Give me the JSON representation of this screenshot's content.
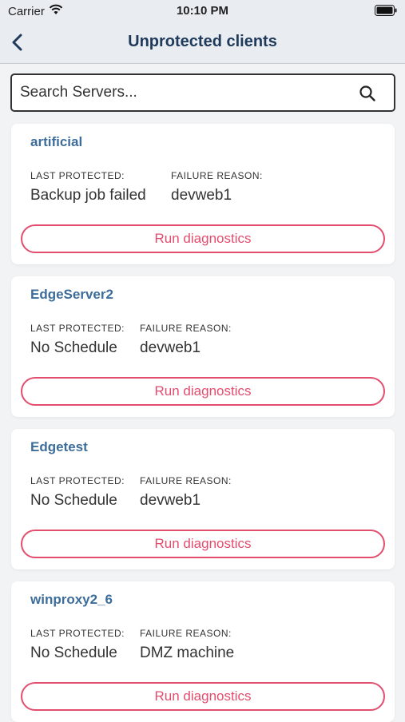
{
  "status_bar": {
    "carrier": "Carrier",
    "time": "10:10 PM",
    "icons": [
      "wifi-icon",
      "battery-icon"
    ]
  },
  "nav": {
    "title": "Unprotected clients",
    "back_icon": "chevron-left-icon"
  },
  "search": {
    "placeholder": "Search Servers...",
    "value": "",
    "icon": "search-icon"
  },
  "labels": {
    "last_protected": "LAST PROTECTED:",
    "failure_reason": "FAILURE REASON:",
    "button": "Run diagnostics"
  },
  "clients": [
    {
      "name": "artificial",
      "last_protected": "Backup job failed",
      "failure_reason": "devweb1"
    },
    {
      "name": "EdgeServer2",
      "last_protected": "No Schedule",
      "failure_reason": "devweb1"
    },
    {
      "name": "Edgetest",
      "last_protected": "No Schedule",
      "failure_reason": "devweb1"
    },
    {
      "name": "winproxy2_6",
      "last_protected": "No Schedule",
      "failure_reason": "DMZ machine"
    }
  ],
  "colors": {
    "accent": "#e34d6e",
    "title": "#1f3a5a",
    "client_name": "#3d6d9a"
  }
}
